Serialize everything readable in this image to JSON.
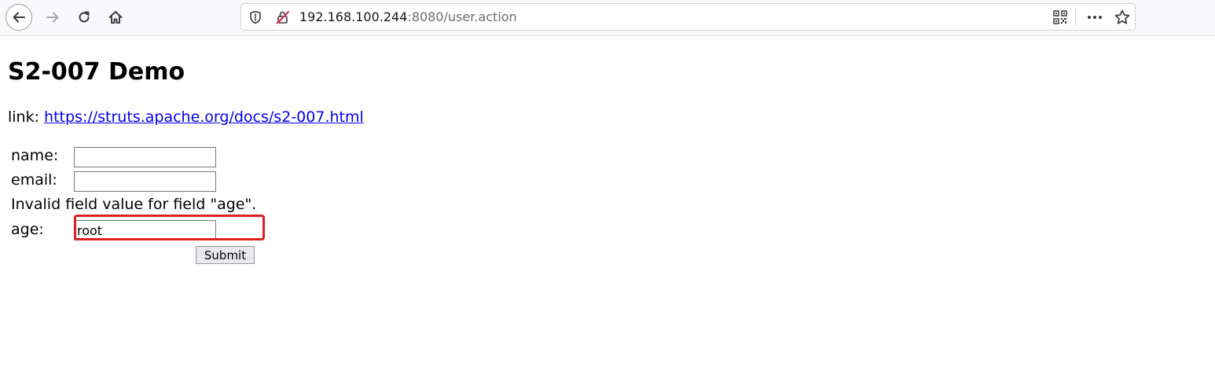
{
  "browser": {
    "url_host": "192.168.100.244",
    "url_rest": ":8080/user.action",
    "icons": {
      "back": "arrow-left",
      "forward": "arrow-right",
      "reload": "reload",
      "home": "home",
      "tracking": "shield",
      "connection": "insecure-lock",
      "qr": "qr-code",
      "menu": "more-horizontal",
      "bookmark": "star"
    }
  },
  "page": {
    "title": "S2-007 Demo",
    "link_prefix": "link: ",
    "link_text": "https://struts.apache.org/docs/s2-007.html",
    "form": {
      "name_label": "name:",
      "name_value": "",
      "email_label": "email:",
      "email_value": "",
      "error_message": "Invalid field value for field \"age\".",
      "age_label": "age:",
      "age_value": "root",
      "submit_label": "Submit"
    }
  },
  "colors": {
    "link": "#0000ee",
    "highlight": "#e02020",
    "insecure": "#e22850"
  }
}
